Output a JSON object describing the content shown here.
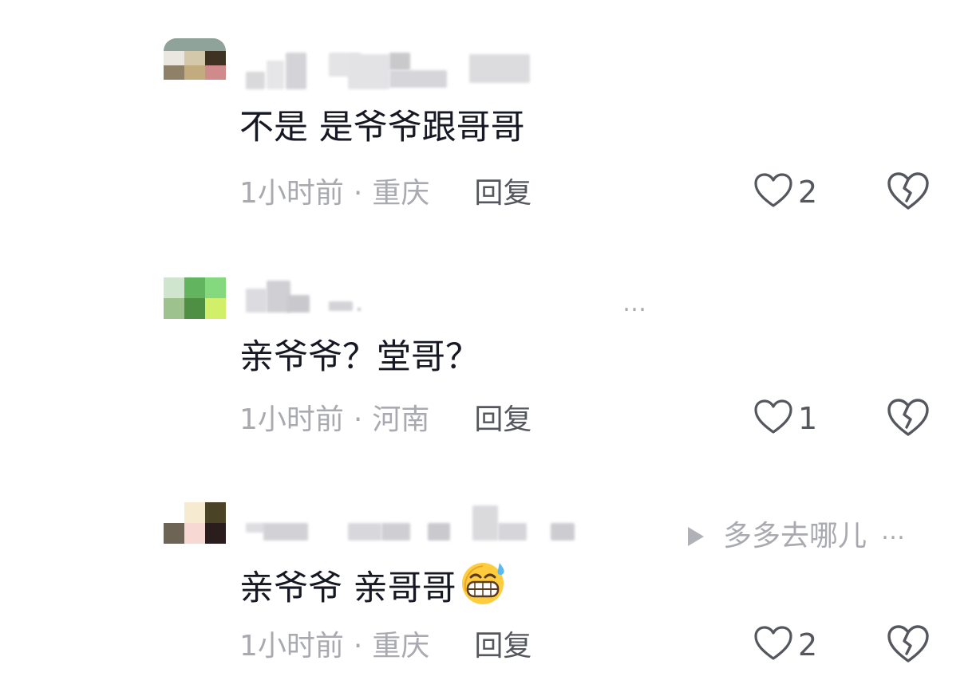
{
  "comments": [
    {
      "text": "不是 是爷爷跟哥哥",
      "time": "1小时前",
      "sep": "·",
      "location": "重庆",
      "reply_label": "回复",
      "like_count": "2"
    },
    {
      "text": "亲爷爷？堂哥？",
      "time": "1小时前",
      "sep": "·",
      "location": "河南",
      "reply_label": "回复",
      "like_count": "1",
      "more_label": "…",
      "music_label": "多多去哪儿"
    },
    {
      "text": "亲爷爷 亲哥哥",
      "time": "1小时前",
      "sep": "·",
      "location": "重庆",
      "reply_label": "回复",
      "like_count": "2",
      "more_label": "…"
    }
  ],
  "icons": {
    "like": "heart-outline-icon",
    "dislike": "broken-heart-icon",
    "music": "play-triangle-icon",
    "emoji": "grinning-sweat-emoji-icon"
  },
  "colors": {
    "text": "#161823",
    "meta": "#a9aab0",
    "reply": "#55575e",
    "background": "#ffffff"
  }
}
